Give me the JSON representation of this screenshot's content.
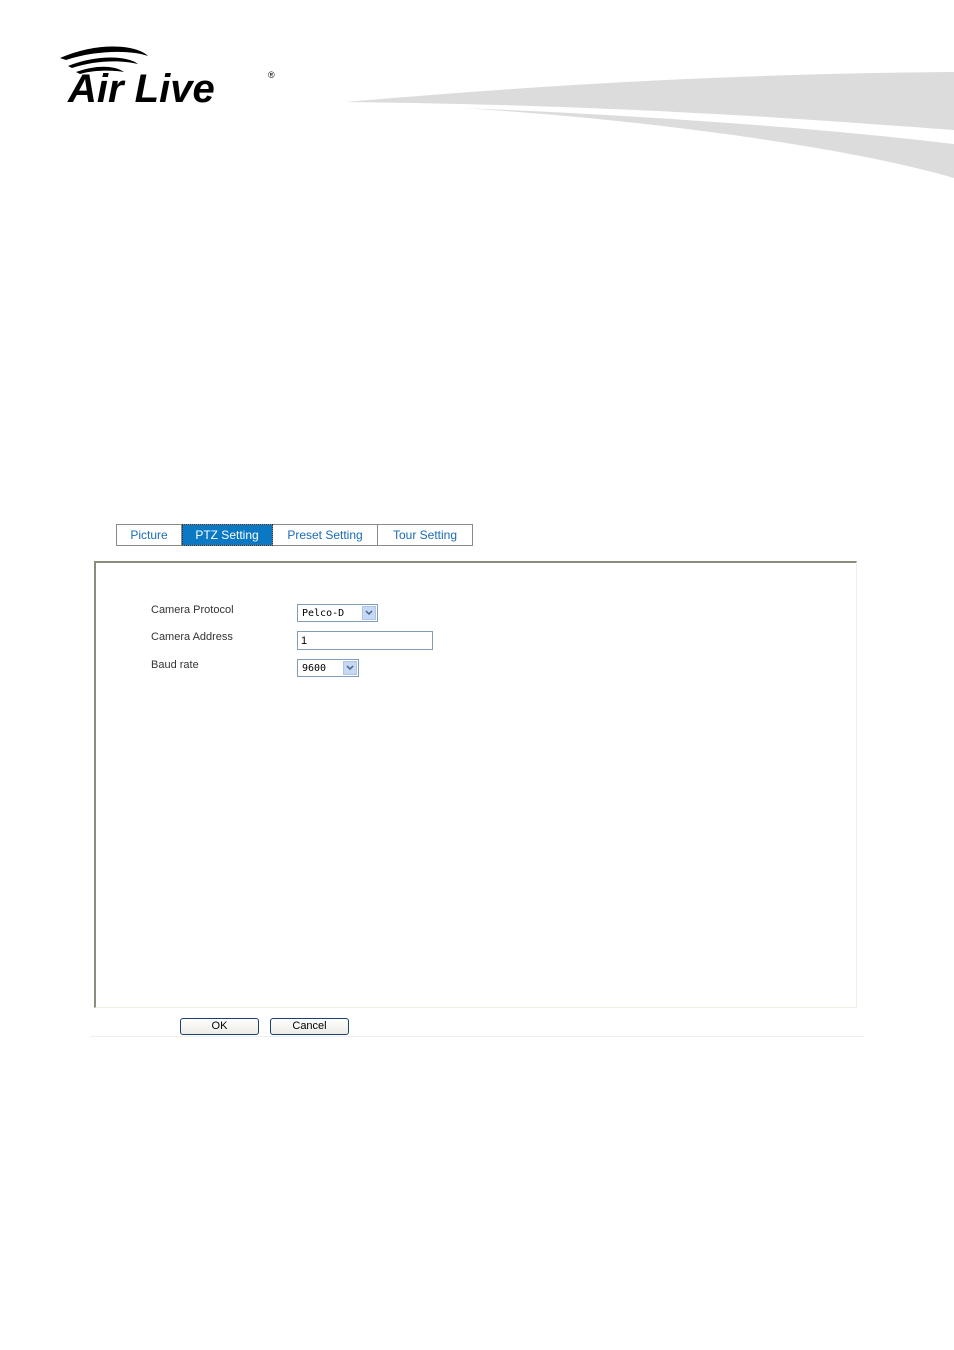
{
  "brand": {
    "logo_text": "Air Live",
    "registered_mark": "®"
  },
  "tabs": [
    {
      "label": "Picture",
      "active": false
    },
    {
      "label": "PTZ Setting",
      "active": true
    },
    {
      "label": "Preset Setting",
      "active": false
    },
    {
      "label": "Tour Setting",
      "active": false
    }
  ],
  "form": {
    "camera_protocol": {
      "label": "Camera Protocol",
      "value": "Pelco-D"
    },
    "camera_address": {
      "label": "Camera Address",
      "value": "1"
    },
    "baud_rate": {
      "label": "Baud rate",
      "value": "9600"
    }
  },
  "buttons": {
    "ok": "OK",
    "cancel": "Cancel"
  },
  "colors": {
    "active_tab": "#0a78c2",
    "tab_text": "#1a6bb5",
    "swoosh": "#dcdcdc"
  }
}
